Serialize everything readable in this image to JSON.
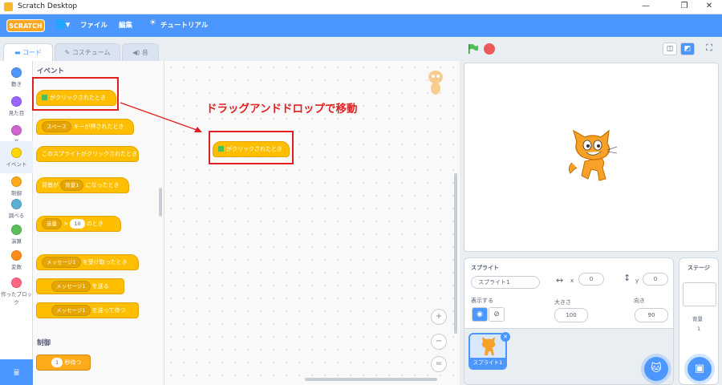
{
  "window": {
    "title": "Scratch Desktop",
    "controls": [
      "—",
      "❐",
      "✕"
    ]
  },
  "menubar": {
    "logo": "SCRATCH",
    "file": "ファイル",
    "edit": "編集",
    "tutorials": "チュートリアル"
  },
  "tabs": {
    "code": "コード",
    "costumes": "コスチューム",
    "sounds": "音"
  },
  "categories": [
    {
      "label": "動き",
      "color": "#4c97ff"
    },
    {
      "label": "見た目",
      "color": "#9966ff"
    },
    {
      "label": "音",
      "color": "#cf63cf"
    },
    {
      "label": "イベント",
      "color": "#ffd500"
    },
    {
      "label": "制御",
      "color": "#ffab19"
    },
    {
      "label": "調べる",
      "color": "#5cb1d6"
    },
    {
      "label": "演算",
      "color": "#59c059"
    },
    {
      "label": "変数",
      "color": "#ff8c1a"
    },
    {
      "label": "作ったブロック",
      "color": "#ff6680"
    }
  ],
  "palette": {
    "events_heading": "イベント",
    "control_heading": "制御",
    "blocks": {
      "flag_clicked": "がクリックされたとき",
      "key_dropdown": "スペース",
      "key_pressed": "キーが押されたとき",
      "sprite_clicked": "このスプライトがクリックされたとき",
      "backdrop_prefix": "背景が",
      "backdrop_dropdown": "背景1",
      "backdrop_suffix": "になったとき",
      "loudness_dropdown": "音量",
      "loudness_op": ">",
      "loudness_value": "10",
      "loudness_suffix": "のとき",
      "message_dropdown": "メッセージ1",
      "receive_suffix": "を受け取ったとき",
      "broadcast_suffix": "を送る",
      "broadcast_wait_suffix": "を送って待つ",
      "wait_value": "1",
      "wait_suffix": "秒待つ"
    }
  },
  "scripts": {
    "annotation": "ドラッグアンドドロップで移動",
    "dropped_block": "がクリックされたとき",
    "zoom_in": "+",
    "zoom_out": "−",
    "zoom_reset": "="
  },
  "sprite_info": {
    "heading": "スプライト",
    "name": "スプライト1",
    "x_label": "x",
    "x_value": "0",
    "y_label": "y",
    "y_value": "0",
    "show_label": "表示する",
    "size_label": "大きさ",
    "size_value": "100",
    "direction_label": "向き",
    "direction_value": "90",
    "thumb_label": "スプライト1"
  },
  "stage_panel": {
    "heading": "ステージ",
    "backdrops_label": "背景",
    "backdrops_count": "1"
  },
  "colors": {
    "accent": "#4c97ff",
    "events": "#ffbf00",
    "annotation": "#e02020"
  }
}
